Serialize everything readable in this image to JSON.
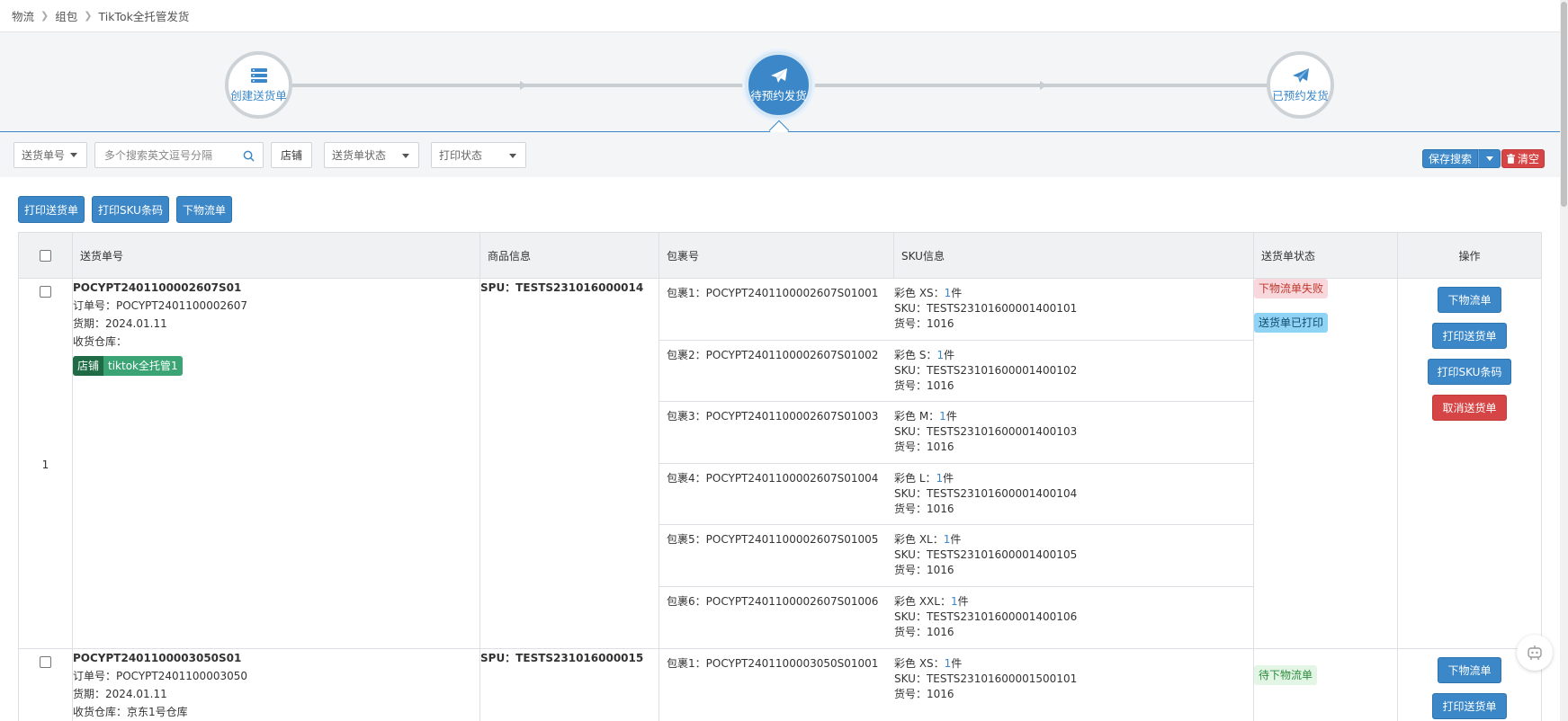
{
  "breadcrumb": [
    "物流",
    "组包",
    "TikTok全托管发货"
  ],
  "steps": [
    {
      "label": "创建送货单",
      "icon": "server-icon",
      "state": "inactive"
    },
    {
      "label": "待预约发货",
      "icon": "paper-plane-icon",
      "state": "active"
    },
    {
      "label": "已预约发货",
      "icon": "paper-plane-icon",
      "state": "inactive"
    }
  ],
  "filters": {
    "field_select": "送货单号",
    "search_placeholder": "多个搜索英文逗号分隔",
    "shop_button": "店铺",
    "status_select": "送货单状态",
    "print_select": "打印状态",
    "save_search": "保存搜索",
    "clear": "清空"
  },
  "actions": [
    "打印送货单",
    "打印SKU条码",
    "下物流单"
  ],
  "table": {
    "headers": [
      "送货单号",
      "商品信息",
      "包裹号",
      "SKU信息",
      "送货单状态",
      "操作"
    ],
    "rows": [
      {
        "index": "1",
        "shipment_no": "POCYPT2401100002607S01",
        "order_label": "订单号：POCYPT2401100002607",
        "date_label": "货期：2024.01.11",
        "warehouse_label": "收货仓库：",
        "shop_tag": [
          "店铺",
          "tiktok全托管1"
        ],
        "spu": "SPU：TESTS231016000014",
        "packages": [
          {
            "pkg": "包裹1：POCYPT2401100002607S01001",
            "spec": "彩色 XS：",
            "qty": "1",
            "unit": "件",
            "sku": "SKU：TESTS23101600001400101",
            "item": "货号：1016"
          },
          {
            "pkg": "包裹2：POCYPT2401100002607S01002",
            "spec": "彩色 S：",
            "qty": "1",
            "unit": "件",
            "sku": "SKU：TESTS23101600001400102",
            "item": "货号：1016"
          },
          {
            "pkg": "包裹3：POCYPT2401100002607S01003",
            "spec": "彩色 M：",
            "qty": "1",
            "unit": "件",
            "sku": "SKU：TESTS23101600001400103",
            "item": "货号：1016"
          },
          {
            "pkg": "包裹4：POCYPT2401100002607S01004",
            "spec": "彩色 L：",
            "qty": "1",
            "unit": "件",
            "sku": "SKU：TESTS23101600001400104",
            "item": "货号：1016"
          },
          {
            "pkg": "包裹5：POCYPT2401100002607S01005",
            "spec": "彩色 XL：",
            "qty": "1",
            "unit": "件",
            "sku": "SKU：TESTS23101600001400105",
            "item": "货号：1016"
          },
          {
            "pkg": "包裹6：POCYPT2401100002607S01006",
            "spec": "彩色 XXL：",
            "qty": "1",
            "unit": "件",
            "sku": "SKU：TESTS23101600001400106",
            "item": "货号：1016"
          }
        ],
        "statuses": [
          "下物流单失败",
          "送货单已打印"
        ],
        "ops": [
          "下物流单",
          "打印送货单",
          "打印SKU条码",
          "取消送货单"
        ]
      },
      {
        "shipment_no": "POCYPT2401100003050S01",
        "order_label": "订单号：POCYPT2401100003050",
        "date_label": "货期：2024.01.11",
        "warehouse_label": "收货仓库：京东1号仓库",
        "spu": "SPU：TESTS231016000015",
        "packages": [
          {
            "pkg": "包裹1：POCYPT2401100003050S01001",
            "spec": "彩色 XS：",
            "qty": "1",
            "unit": "件",
            "sku": "SKU：TESTS23101600001500101",
            "item": "货号：1016"
          }
        ],
        "statuses": [
          "待下物流单"
        ],
        "ops": [
          "下物流单",
          "打印送货单"
        ]
      }
    ]
  },
  "colors": {
    "primary": "#3b87c8",
    "danger": "#d64545",
    "shop_tag": "#1e6b46"
  }
}
